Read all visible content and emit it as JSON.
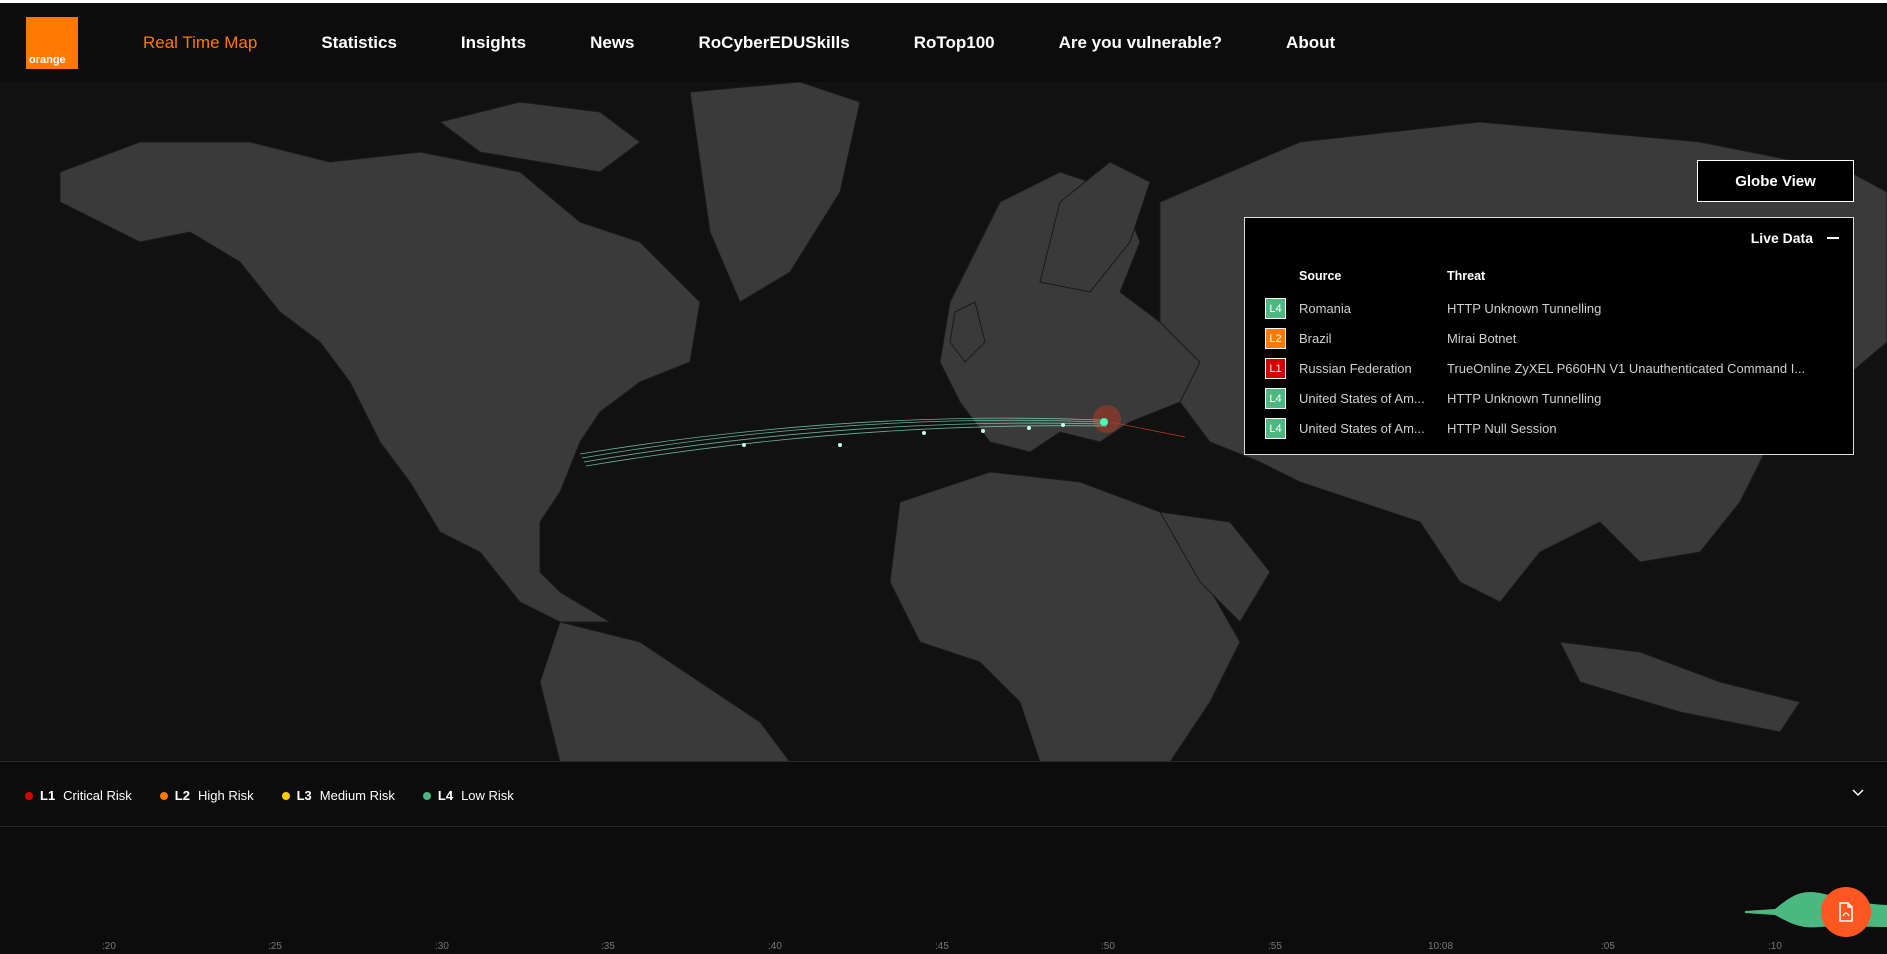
{
  "brand": {
    "logo_text": "orange",
    "accent": "#ff7900"
  },
  "nav": {
    "items": [
      {
        "label": "Real Time Map",
        "active": true
      },
      {
        "label": "Statistics"
      },
      {
        "label": "Insights"
      },
      {
        "label": "News"
      },
      {
        "label": "RoCyberEDUSkills"
      },
      {
        "label": "RoTop100"
      },
      {
        "label": "Are you vulnerable?"
      },
      {
        "label": "About"
      }
    ]
  },
  "map": {
    "globe_button": "Globe View"
  },
  "live_data": {
    "title": "Live Data",
    "col_source": "Source",
    "col_threat": "Threat",
    "rows": [
      {
        "level": "L4",
        "source": "Romania",
        "threat": "HTTP Unknown Tunnelling"
      },
      {
        "level": "L2",
        "source": "Brazil",
        "threat": "Mirai Botnet"
      },
      {
        "level": "L1",
        "source": "Russian Federation",
        "threat": "TrueOnline ZyXEL P660HN V1 Unauthenticated Command I..."
      },
      {
        "level": "L4",
        "source": "United States of Am...",
        "threat": "HTTP Unknown Tunnelling"
      },
      {
        "level": "L4",
        "source": "United States of Am...",
        "threat": "HTTP Null Session"
      }
    ]
  },
  "legend": [
    {
      "level": "L1",
      "label": "Critical Risk",
      "color": "#d60000"
    },
    {
      "level": "L2",
      "label": "High Risk",
      "color": "#ff7900"
    },
    {
      "level": "L3",
      "label": "Medium Risk",
      "color": "#ffcc00"
    },
    {
      "level": "L4",
      "label": "Low Risk",
      "color": "#4bb87f"
    }
  ],
  "level_colors": {
    "L1": "#d60000",
    "L2": "#ff7900",
    "L3": "#ffcc00",
    "L4": "#4bb87f"
  },
  "timeline": {
    "ticks": [
      ":20",
      ":25",
      ":30",
      ":35",
      ":40",
      ":45",
      ":50",
      ":55",
      "10:08",
      ":05",
      ":10"
    ]
  }
}
